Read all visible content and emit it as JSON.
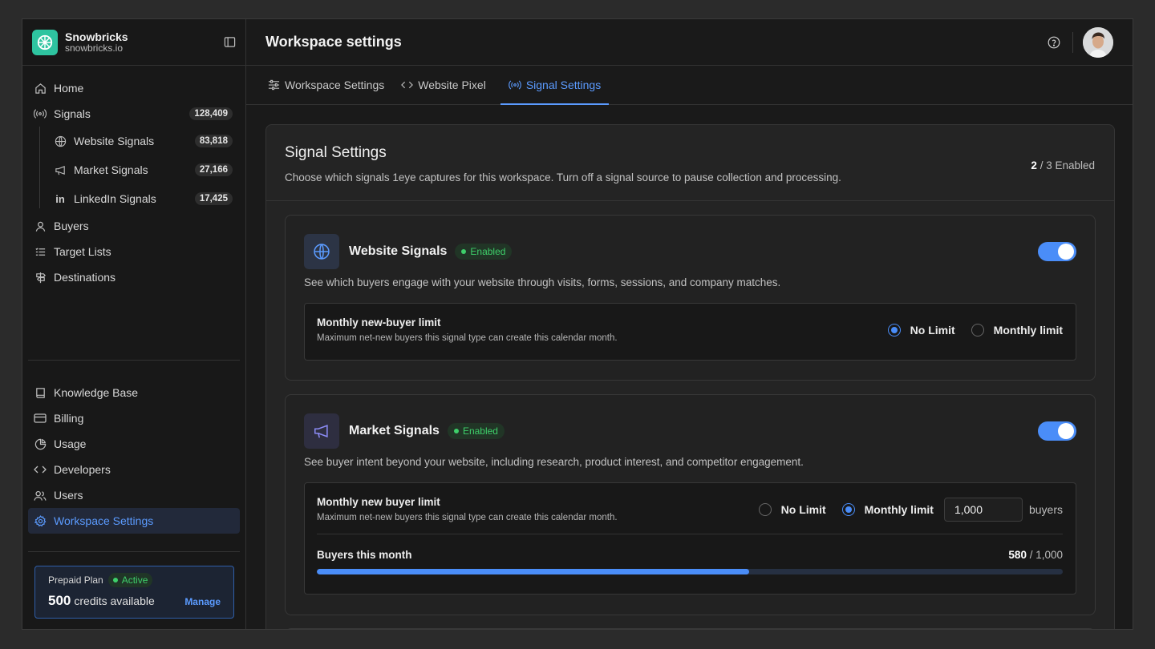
{
  "brand": {
    "name": "Snowbricks",
    "domain": "snowbricks.io",
    "color": "#2ec4a0"
  },
  "header": {
    "title": "Workspace settings"
  },
  "sidebar": {
    "items": [
      {
        "label": "Home",
        "icon": "home-icon"
      },
      {
        "label": "Signals",
        "icon": "signal-icon",
        "count": "128,409"
      }
    ],
    "sub_items": [
      {
        "label": "Website Signals",
        "icon": "globe-icon",
        "count": "83,818"
      },
      {
        "label": "Market Signals",
        "icon": "megaphone-icon",
        "count": "27,166"
      },
      {
        "label": "LinkedIn Signals",
        "icon": "linkedin-icon",
        "count": "17,425"
      }
    ],
    "items2": [
      {
        "label": "Buyers",
        "icon": "user-icon"
      },
      {
        "label": "Target Lists",
        "icon": "list-icon"
      },
      {
        "label": "Destinations",
        "icon": "signpost-icon"
      }
    ],
    "bottom_items": [
      {
        "label": "Knowledge Base",
        "icon": "book-icon"
      },
      {
        "label": "Billing",
        "icon": "credit-card-icon"
      },
      {
        "label": "Usage",
        "icon": "pie-chart-icon"
      },
      {
        "label": "Developers",
        "icon": "code-icon"
      },
      {
        "label": "Users",
        "icon": "users-icon"
      },
      {
        "label": "Workspace Settings",
        "icon": "gear-icon",
        "active": true
      }
    ]
  },
  "plan": {
    "name": "Prepaid Plan",
    "status": "Active",
    "credits": "500",
    "credits_label": "credits available",
    "manage": "Manage"
  },
  "tabs": [
    {
      "label": "Workspace Settings",
      "icon": "sliders-icon"
    },
    {
      "label": "Website Pixel",
      "icon": "code-icon"
    },
    {
      "label": "Signal Settings",
      "icon": "signal-icon",
      "active": true
    }
  ],
  "panel": {
    "title": "Signal Settings",
    "description": "Choose which signals 1eye captures for this workspace. Turn off a signal source to pause collection and processing.",
    "enabled_num": "2",
    "enabled_rest": " / 3 Enabled"
  },
  "cards": [
    {
      "title": "Website Signals",
      "badge": "Enabled",
      "enabled": true,
      "description": "See which buyers engage with your website through visits, forms, sessions, and company matches.",
      "limit_title": "Monthly new-buyer limit",
      "limit_sub": "Maximum net-new buyers this signal type can create this calendar month.",
      "option_no_limit": "No Limit",
      "option_monthly": "Monthly limit",
      "selected": "no_limit"
    },
    {
      "title": "Market Signals",
      "badge": "Enabled",
      "enabled": true,
      "description": "See buyer intent beyond your website, including research, product interest, and competitor engagement.",
      "limit_title": "Monthly new buyer limit",
      "limit_sub": "Maximum net-new buyers this signal type can create this calendar month.",
      "option_no_limit": "No Limit",
      "option_monthly": "Monthly limit",
      "selected": "monthly",
      "limit_value": "1,000",
      "limit_unit": "buyers",
      "progress_label": "Buyers this month",
      "progress_used": "580",
      "progress_total": " / 1,000",
      "progress_fraction": 0.58
    }
  ],
  "colors": {
    "accent": "#4a8df8",
    "link": "#5b9bff",
    "success": "#3ecf6a"
  }
}
